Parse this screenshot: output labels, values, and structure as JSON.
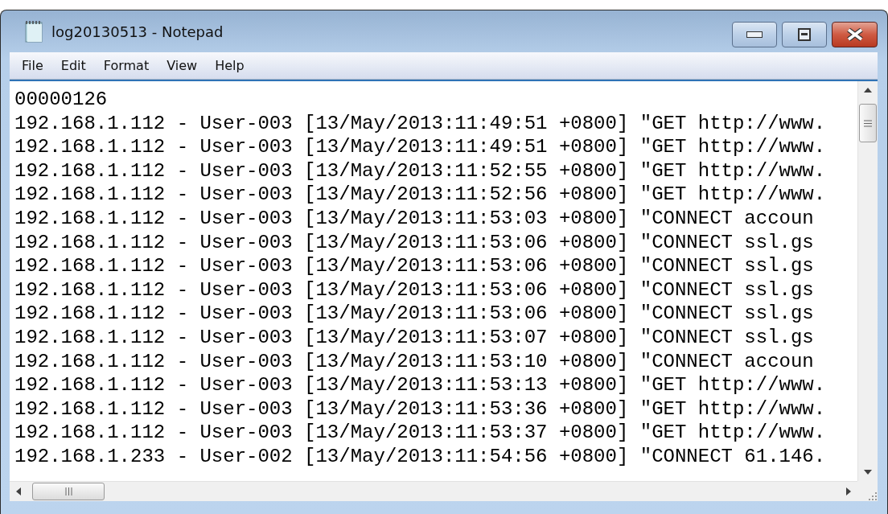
{
  "window": {
    "title": "log20130513 - Notepad"
  },
  "menu": [
    "File",
    "Edit",
    "Format",
    "View",
    "Help"
  ],
  "lines": [
    "00000126",
    "192.168.1.112 - User-003 [13/May/2013:11:49:51 +0800] \"GET http://www.",
    "192.168.1.112 - User-003 [13/May/2013:11:49:51 +0800] \"GET http://www.",
    "192.168.1.112 - User-003 [13/May/2013:11:52:55 +0800] \"GET http://www.",
    "192.168.1.112 - User-003 [13/May/2013:11:52:56 +0800] \"GET http://www.",
    "192.168.1.112 - User-003 [13/May/2013:11:53:03 +0800] \"CONNECT accoun",
    "192.168.1.112 - User-003 [13/May/2013:11:53:06 +0800] \"CONNECT ssl.gs",
    "192.168.1.112 - User-003 [13/May/2013:11:53:06 +0800] \"CONNECT ssl.gs",
    "192.168.1.112 - User-003 [13/May/2013:11:53:06 +0800] \"CONNECT ssl.gs",
    "192.168.1.112 - User-003 [13/May/2013:11:53:06 +0800] \"CONNECT ssl.gs",
    "192.168.1.112 - User-003 [13/May/2013:11:53:07 +0800] \"CONNECT ssl.gs",
    "192.168.1.112 - User-003 [13/May/2013:11:53:10 +0800] \"CONNECT accoun",
    "192.168.1.112 - User-003 [13/May/2013:11:53:13 +0800] \"GET http://www.",
    "192.168.1.112 - User-003 [13/May/2013:11:53:36 +0800] \"GET http://www.",
    "192.168.1.112 - User-003 [13/May/2013:11:53:37 +0800] \"GET http://www.",
    "192.168.1.233 - User-002 [13/May/2013:11:54:56 +0800] \"CONNECT 61.146."
  ]
}
